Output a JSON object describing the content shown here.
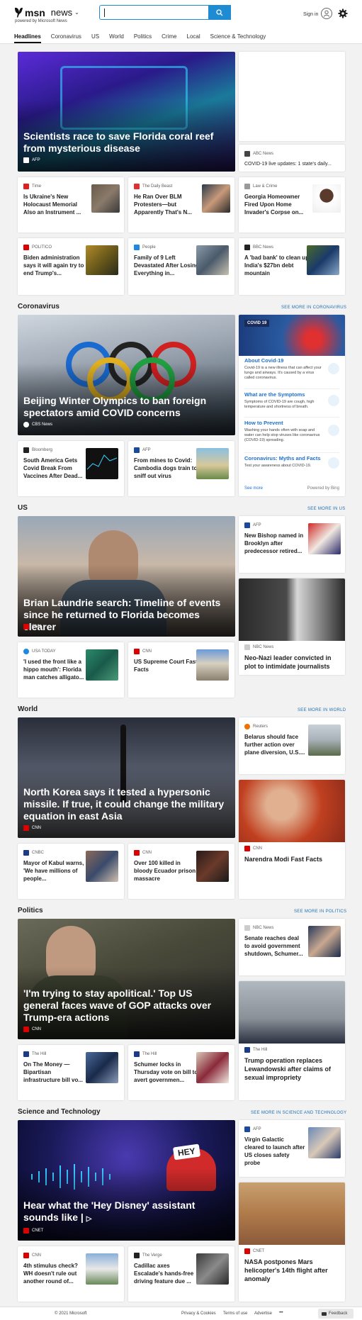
{
  "header": {
    "brand": "msn",
    "section": "news",
    "powered": "powered by Microsoft News",
    "search_placeholder": "",
    "signin": "Sign in"
  },
  "nav": [
    "Headlines",
    "Coronavirus",
    "US",
    "World",
    "Politics",
    "Crime",
    "Local",
    "Science & Technology"
  ],
  "top": {
    "hero": {
      "title": "Scientists race to save Florida coral reef from mysterious disease",
      "source": "AFP"
    },
    "side": {
      "source": "ABC News",
      "title": "COVID-19 live updates: 1 state's daily..."
    },
    "cards": [
      {
        "source": "Time",
        "title": "Is Ukraine's New Holocaust Memorial Also an Instrument ..."
      },
      {
        "source": "The Daily Beast",
        "title": "He Ran Over BLM Protesters—but Apparently That's N..."
      },
      {
        "source": "Law & Crime",
        "title": "Georgia Homeowner Fired Upon Home Invader's Corpse on..."
      },
      {
        "source": "POLITICO",
        "title": "Biden administration says it will again try to end Trump's..."
      },
      {
        "source": "People",
        "title": "Family of 9 Left Devastated After Losing Everything in..."
      },
      {
        "source": "BBC News",
        "title": "A 'bad bank' to clean up India's $27bn debt mountain"
      }
    ]
  },
  "corona": {
    "heading": "Coronavirus",
    "more": "SEE MORE IN CORONAVIRUS",
    "hero": {
      "title": "Beijing Winter Olympics to ban foreign spectators amid COVID concerns",
      "source": "CBS News"
    },
    "cards": [
      {
        "source": "Bloomberg",
        "title": "South America Gets Covid Break From Vaccines After Dead..."
      },
      {
        "source": "AFP",
        "title": "From mines to Covid: Cambodia dogs train to sniff out virus"
      }
    ],
    "info": {
      "badge": "COVID 19",
      "items": [
        {
          "title": "About Covid-19",
          "text": "Covid-19 is a new illness that can affect your lungs and airways. It's caused by a virus called coronavirus."
        },
        {
          "title": "What are the Symptoms",
          "text": "Symptoms of COVID-19 are cough, high temperature and shortness of breath."
        },
        {
          "title": "How to Prevent",
          "text": "Washing your hands often with soap and water can help stop viruses like coronavirus (COVID-19) spreading."
        },
        {
          "title": "Coronavirus: Myths and Facts",
          "text": "Test your awareness about COVID-19."
        }
      ],
      "see_more": "See more",
      "powered": "Powered by Bing"
    }
  },
  "us": {
    "heading": "US",
    "more": "SEE MORE IN US",
    "hero": {
      "title": "Brian Laundrie search: Timeline of events since he returned to Florida becomes clearer",
      "source": "CNN"
    },
    "side1": {
      "source": "AFP",
      "title": "New Bishop named in Brooklyn after predecessor retired..."
    },
    "side2": {
      "source": "NBC News",
      "title": "Neo-Nazi leader convicted in plot to intimidate journalists"
    },
    "cards": [
      {
        "source": "USA TODAY",
        "title": "'I used the front like a hippo mouth': Florida man catches alligato..."
      },
      {
        "source": "CNN",
        "title": "US Supreme Court Fast Facts"
      }
    ]
  },
  "world": {
    "heading": "World",
    "more": "SEE MORE IN WORLD",
    "hero": {
      "title": "North Korea says it tested a hypersonic missile. If true, it could change the military equation in east Asia",
      "source": "CNN"
    },
    "side1": {
      "source": "Reuters",
      "title": "Belarus should face further action over plane diversion, U.S...."
    },
    "side2": {
      "source": "CNN",
      "title": "Narendra Modi Fast Facts"
    },
    "cards": [
      {
        "source": "CNBC",
        "title": "Mayor of Kabul warns, 'We have millions of people..."
      },
      {
        "source": "CNN",
        "title": "Over 100 killed in bloody Ecuador prison massacre"
      }
    ]
  },
  "politics": {
    "heading": "Politics",
    "more": "SEE MORE IN POLITICS",
    "hero": {
      "title": "'I'm trying to stay apolitical.' Top US general faces wave of GOP attacks over Trump-era actions",
      "source": "CNN"
    },
    "side1": {
      "source": "NBC News",
      "title": "Senate reaches deal to avoid government shutdown, Schumer..."
    },
    "side2": {
      "source": "The Hill",
      "title": "Trump operation replaces Lewandowski after claims of sexual impropriety"
    },
    "cards": [
      {
        "source": "The Hill",
        "title": "On The Money — Bipartisan infrastructure bill vo..."
      },
      {
        "source": "The Hill",
        "title": "Schumer locks in Thursday vote on bill to avert governmen..."
      }
    ]
  },
  "scitech": {
    "heading": "Science and Technology",
    "more": "SEE MORE IN SCIENCE AND TECHNOLOGY",
    "hero": {
      "title": "Hear what the 'Hey Disney' assistant sounds like |",
      "source": "CNET",
      "sign": "HEY"
    },
    "side1": {
      "source": "AFP",
      "title": "Virgin Galactic cleared to launch after US closes safety probe"
    },
    "side2": {
      "source": "CNET",
      "title": "NASA postpones Mars helicopter's 14th flight after anomaly"
    },
    "cards": [
      {
        "source": "CNN",
        "title": "4th stimulus check? WH doesn't rule out another round of..."
      },
      {
        "source": "The Verge",
        "title": "Cadillac axes Escalade's hands-free driving feature due ..."
      }
    ]
  },
  "footer": {
    "copyright": "© 2021 Microsoft",
    "privacy": "Privacy & Cookies",
    "terms": "Terms of use",
    "advertise": "Advertise",
    "ellipsis": "• • •",
    "feedback": "Feedback"
  }
}
